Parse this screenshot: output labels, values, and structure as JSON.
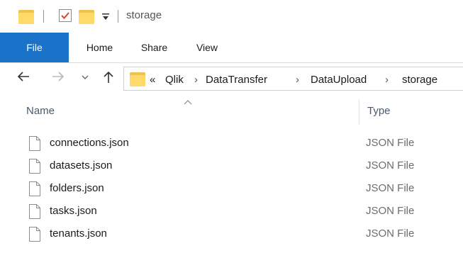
{
  "window": {
    "title": "storage"
  },
  "ribbon": {
    "tabs": [
      {
        "label": "File"
      },
      {
        "label": "Home"
      },
      {
        "label": "Share"
      },
      {
        "label": "View"
      }
    ],
    "accent": "#1a73c9"
  },
  "navigation": {
    "back_icon": "back-arrow-icon",
    "forward_icon": "forward-arrow-icon",
    "recent_icon": "chevron-down-icon",
    "up_icon": "up-arrow-icon"
  },
  "address": {
    "overflow": "«",
    "crumbs": [
      "Qlik",
      "DataTransfer",
      "DataUpload",
      "storage"
    ],
    "separator": "›"
  },
  "columns": {
    "name": "Name",
    "type": "Type"
  },
  "files": [
    {
      "name": "connections.json",
      "type": "JSON File"
    },
    {
      "name": "datasets.json",
      "type": "JSON File"
    },
    {
      "name": "folders.json",
      "type": "JSON File"
    },
    {
      "name": "tasks.json",
      "type": "JSON File"
    },
    {
      "name": "tenants.json",
      "type": "JSON File"
    }
  ]
}
